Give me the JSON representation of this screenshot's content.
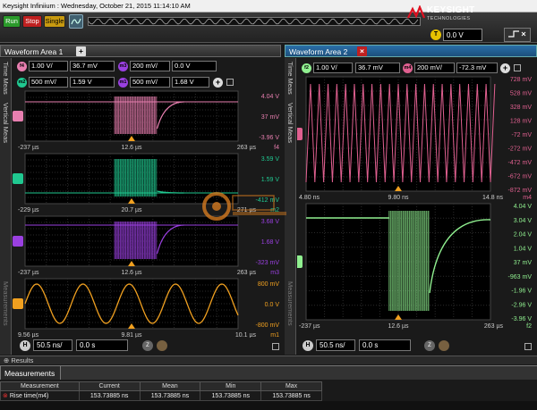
{
  "titlebar": {
    "text": "Keysight Infiniium : Wednesday, October 21, 2015 11:14:10 AM"
  },
  "toolbar": {
    "run_label": "Run",
    "stop_label": "Stop",
    "single_label": "Single",
    "trigger_icon": "T",
    "trigger_level": "0.0 V"
  },
  "logo": {
    "name": "KEYSIGHT",
    "sub": "TECHNOLOGIES"
  },
  "area1": {
    "tab_label": "Waveform Area 1",
    "side_tab_time": "Time Meas",
    "side_tab_vertical": "Vertical Meas",
    "side_tab_measurements": "Measurements",
    "controls_row1": {
      "f_icon": "f4",
      "f_scale": "1.00 V/",
      "f_offset": "36.7 mV",
      "m_icon": "m3",
      "m_scale": "200 mV/",
      "m_offset": "0.0 V"
    },
    "controls_row2": {
      "a_icon": "m2",
      "a_scale": "500 mV/",
      "a_offset": "1.59 V",
      "b_icon": "m1",
      "b_scale": "500 mV/",
      "b_offset": "1.68 V"
    },
    "panels": [
      {
        "name": "f4",
        "color": "#e87fb0",
        "top_label": "4.04 V",
        "mid_label": "37 mV",
        "bot_label": "-3.96 V",
        "x_left": "-237 µs",
        "x_mid": "12.6 µs",
        "x_right": "263 µs",
        "tag": "f4"
      },
      {
        "name": "m2",
        "color": "#20c890",
        "top_label": "3.59 V",
        "mid_label": "1.59 V",
        "bot_label": "-412 mV",
        "x_left": "-229 µs",
        "x_mid": "20.7 µs",
        "x_right": "271 µs",
        "tag": "m2"
      },
      {
        "name": "m3",
        "color": "#9a40e0",
        "top_label": "3.68 V",
        "mid_label": "1.68 V",
        "bot_label": "-323 mV",
        "x_left": "-237 µs",
        "x_mid": "12.6 µs",
        "x_right": "263 µs",
        "tag": "m3"
      },
      {
        "name": "m1",
        "color": "#f0a020",
        "top_label": "800 mV",
        "mid_label": "0.0 V",
        "bot_label": "-800 mV",
        "x_left": "9.56 µs",
        "x_mid": "9.81 µs",
        "x_right": "10.1 µs",
        "tag": "m1"
      }
    ],
    "horizontal": {
      "h_icon": "H",
      "scale": "50.5 ns/",
      "position": "0.0 s",
      "z_icon": "Z"
    }
  },
  "area2": {
    "tab_label": "Waveform Area 2",
    "side_tab_time": "Time Meas",
    "side_tab_vertical": "Vertical Meas",
    "side_tab_measurements": "Measurements",
    "controls_row1": {
      "f_icon": "f2",
      "f_scale": "1.00 V/",
      "f_offset": "36.7 mV",
      "m_icon": "m4",
      "m_scale": "200 mV/",
      "m_offset": "-72.3 mV"
    },
    "panels": [
      {
        "name": "m4",
        "color": "#e06090",
        "labels": [
          "728 mV",
          "528 mV",
          "328 mV",
          "128 mV",
          "-72 mV",
          "-272 mV",
          "-472 mV",
          "-672 mV",
          "-872 mV"
        ],
        "x_left": "4.80 ns",
        "x_mid": "9.80 ns",
        "x_right": "14.8 ns",
        "tag": "m4"
      },
      {
        "name": "f2",
        "color": "#90f090",
        "labels": [
          "4.04 V",
          "3.04 V",
          "2.04 V",
          "1.04 V",
          "37 mV",
          "-963 mV",
          "-1.96 V",
          "-2.96 V",
          "-3.96 V"
        ],
        "x_left": "-237 µs",
        "x_mid": "12.6 µs",
        "x_right": "263 µs",
        "tag": "f2"
      }
    ],
    "horizontal": {
      "h_icon": "H",
      "scale": "50.5 ns/",
      "position": "0.0 s",
      "z_icon": "Z"
    }
  },
  "results_bar": {
    "label": "Results"
  },
  "measurements": {
    "tab_label": "Measurements",
    "columns": [
      "Measurement",
      "Current",
      "Mean",
      "Min",
      "Max"
    ],
    "rows": [
      {
        "name": "Rise time(m4)",
        "current": "153.73885 ns",
        "mean": "153.73885 ns",
        "min": "153.73885 ns",
        "max": "153.73885 ns"
      }
    ]
  }
}
